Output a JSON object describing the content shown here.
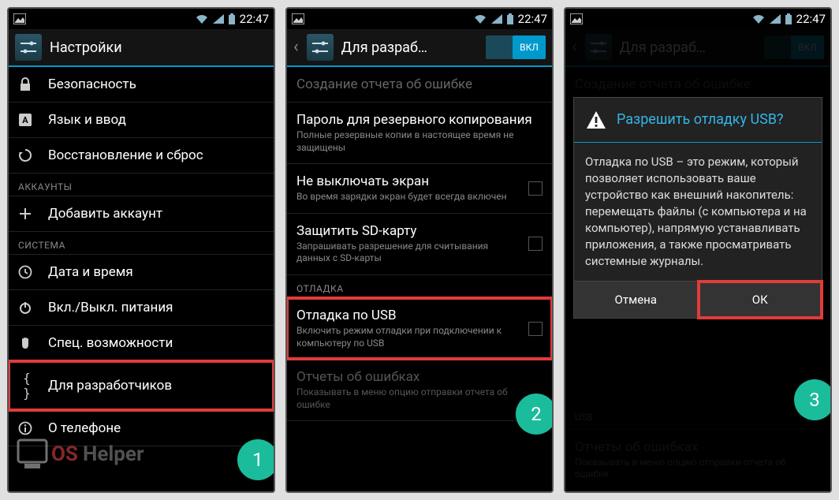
{
  "statusbar": {
    "time": "22:47"
  },
  "colors": {
    "accent": "#0099cc",
    "highlight": "#e23b3b",
    "badge": "#1abc9c",
    "dialog_title": "#33b5e5"
  },
  "phone1": {
    "header": {
      "title": "Настройки"
    },
    "items": [
      {
        "icon": "lock-icon",
        "title": "Безопасность"
      },
      {
        "icon": "language-icon",
        "title": "Язык и ввод"
      },
      {
        "icon": "restore-icon",
        "title": "Восстановление и сброс"
      }
    ],
    "cat_accounts": "АККАУНТЫ",
    "add_account": {
      "icon": "plus-icon",
      "title": "Добавить аккаунт"
    },
    "cat_system": "СИСТЕМА",
    "system_items": [
      {
        "icon": "clock-icon",
        "title": "Дата и время"
      },
      {
        "icon": "power-icon",
        "title": "Вкл./Выкл. питания"
      },
      {
        "icon": "hand-icon",
        "title": "Спец. возможности"
      },
      {
        "icon": "braces-icon",
        "title": "Для разработчиков"
      },
      {
        "icon": "info-icon",
        "title": "О телефоне"
      }
    ],
    "step": "1"
  },
  "phone2": {
    "header": {
      "title": "Для разраб…",
      "toggle": "ВКЛ"
    },
    "items": [
      {
        "title": "Создание отчета об ошибке",
        "disabled": true
      },
      {
        "title": "Пароль для резервного копирования",
        "subtitle": "Полные резервные копии в настоящее время не защищены"
      },
      {
        "title": "Не выключать экран",
        "subtitle": "Во время зарядки экран будет всегда включен",
        "checkbox": true
      },
      {
        "title": "Защитить SD-карту",
        "subtitle": "Запрашивать разрешение для считывания данных с SD-карты",
        "checkbox": true
      }
    ],
    "cat_debug": "ОТЛАДКА",
    "debug_item": {
      "title": "Отладка по USB",
      "subtitle": "Включить режим отладки при подключении к компьютеру по USB",
      "checkbox": true
    },
    "reports_item": {
      "title": "Отчеты об ошибках",
      "subtitle": "Показывать в меню опцию отправки отчета об ошибке",
      "disabled": true
    },
    "step": "2"
  },
  "phone3": {
    "header": {
      "title": "Для разраб…",
      "toggle": "ВКЛ"
    },
    "dialog": {
      "title": "Разрешить отладку USB?",
      "body": "Отладка по USB – это режим, который позволяет использовать ваше устройство как внешний накопитель: перемещать файлы (с компьютера и на компьютер), напрямую устанавливать приложения, а также просматривать системные журналы.",
      "cancel": "Отмена",
      "ok": "ОК"
    },
    "bg_items": [
      {
        "title": "Создание отчета об ошибке"
      }
    ],
    "bg_usb_label": "USB",
    "bg_reports": {
      "title": "Отчеты об ошибках",
      "subtitle": "Показывать в меню опцию отправки отчета об ошибке"
    },
    "step": "3"
  },
  "watermark": {
    "text1": "OS",
    "text2": "Helper"
  }
}
